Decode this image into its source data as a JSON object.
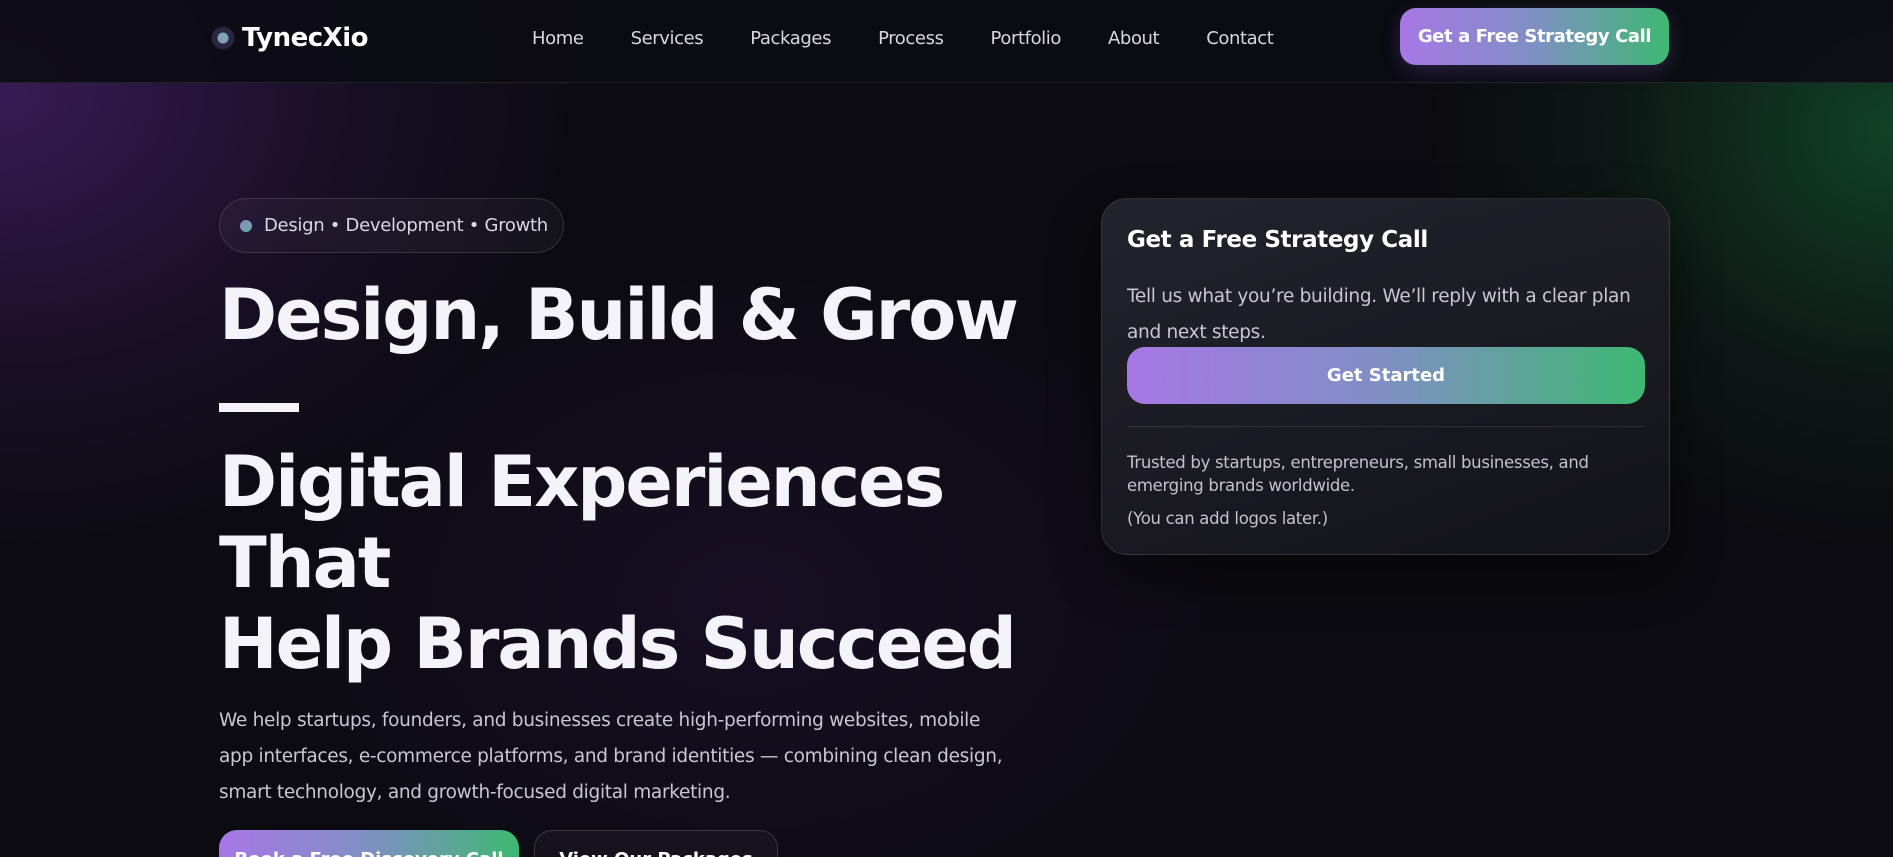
{
  "nav": {
    "brand": "TynecXio",
    "links": [
      "Home",
      "Services",
      "Packages",
      "Process",
      "Portfolio",
      "About",
      "Contact"
    ],
    "cta_label": "Get a Free Strategy Call"
  },
  "hero": {
    "tag": "Design • Development • Growth",
    "title_line1": "Design, Build & Grow",
    "title_line2": "Digital Experiences",
    "title_line3": "That",
    "title_line4": "Help Brands Succeed",
    "description": "We help startups, founders, and businesses create high-performing websites, mobile app interfaces, e-commerce platforms, and brand identities — combining clean design, smart technology, and growth-focused digital marketing.",
    "primary_button": "Book a Free Discovery Call",
    "secondary_button": "View Our Packages"
  },
  "card": {
    "title": "Get a Free Strategy Call",
    "text": "Tell us what you’re building. We’ll reply with a clear plan and next steps.",
    "button": "Get Started",
    "trust": "Trusted by startups, entrepreneurs, small businesses, and emerging brands worldwide.",
    "note": "(You can add logos later.)"
  },
  "colors": {
    "gradient_start": "#a777e6",
    "gradient_end": "#3eb872",
    "background": "#0c0b11"
  }
}
